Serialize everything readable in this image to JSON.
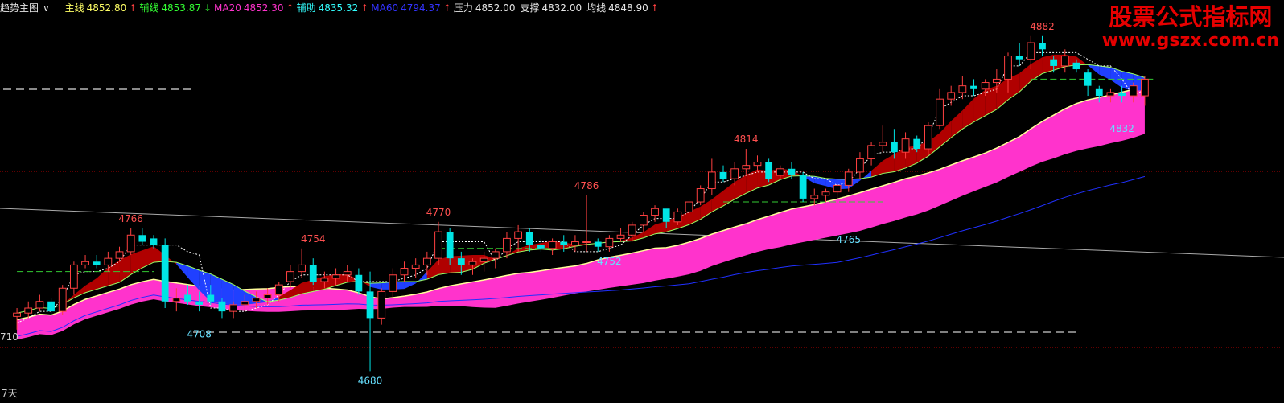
{
  "header": {
    "menu_label": "趋势主图",
    "menu_arrow": "∨",
    "items": [
      {
        "name": "主线",
        "value": "4852.80",
        "arrow": "↑",
        "color": "#ffff66"
      },
      {
        "name": "辅线",
        "value": "4853.87",
        "arrow": "↓",
        "color": "#33ff33"
      },
      {
        "name": "MA20",
        "value": "4852.30",
        "arrow": "↑",
        "color": "#ff33cc"
      },
      {
        "name": "辅助",
        "value": "4835.32",
        "arrow": "↑",
        "color": "#33ffff"
      },
      {
        "name": "MA60",
        "value": "4794.37",
        "arrow": "↑",
        "color": "#3333ff"
      },
      {
        "name": "压力",
        "value": "4852.00",
        "arrow": "",
        "color": "#e6e6e6"
      },
      {
        "name": "支撑",
        "value": "4832.00",
        "arrow": "",
        "color": "#e6e6e6"
      },
      {
        "name": "均线",
        "value": "4848.90",
        "arrow": "↑",
        "color": "#e6e6e6"
      }
    ]
  },
  "watermark": {
    "title": "股票公式指标网",
    "url": "www.gszx.com.cn",
    "title_color": "#e60000",
    "url_color": "#e60000"
  },
  "bottom_label": "7天",
  "left_label": "710",
  "colors": {
    "up": "#ff4040",
    "down": "#00e5e5",
    "ma60": "#2030ff",
    "band_pink": "#ff33cc",
    "band_red": "#b00000",
    "band_blue": "#2040ff",
    "grid": "#c00000"
  },
  "chart_data": {
    "type": "candlestick",
    "ylim": [
      4670,
      4895
    ],
    "candles": [
      [
        4713,
        4718,
        4705,
        4715
      ],
      [
        4715,
        4722,
        4712,
        4718
      ],
      [
        4718,
        4726,
        4716,
        4722
      ],
      [
        4722,
        4724,
        4714,
        4716
      ],
      [
        4716,
        4732,
        4714,
        4730
      ],
      [
        4730,
        4746,
        4726,
        4744
      ],
      [
        4744,
        4750,
        4742,
        4746
      ],
      [
        4746,
        4750,
        4742,
        4744
      ],
      [
        4744,
        4752,
        4740,
        4748
      ],
      [
        4748,
        4755,
        4746,
        4752
      ],
      [
        4752,
        4766,
        4750,
        4762
      ],
      [
        4762,
        4766,
        4756,
        4758
      ],
      [
        4760,
        4762,
        4754,
        4756
      ],
      [
        4756,
        4760,
        4718,
        4722
      ],
      [
        4722,
        4730,
        4716,
        4724
      ],
      [
        4726,
        4732,
        4720,
        4722
      ],
      [
        4722,
        4728,
        4716,
        4720
      ],
      [
        4726,
        4732,
        4720,
        4722
      ],
      [
        4722,
        4724,
        4712,
        4716
      ],
      [
        4716,
        4722,
        4712,
        4720
      ],
      [
        4720,
        4726,
        4716,
        4722
      ],
      [
        4722,
        4728,
        4718,
        4724
      ],
      [
        4724,
        4730,
        4720,
        4726
      ],
      [
        4726,
        4734,
        4722,
        4732
      ],
      [
        4734,
        4744,
        4730,
        4740
      ],
      [
        4740,
        4754,
        4736,
        4744
      ],
      [
        4744,
        4748,
        4732,
        4734
      ],
      [
        4734,
        4740,
        4730,
        4736
      ],
      [
        4736,
        4742,
        4732,
        4738
      ],
      [
        4738,
        4744,
        4734,
        4740
      ],
      [
        4738,
        4742,
        4726,
        4728
      ],
      [
        4728,
        4740,
        4680,
        4712
      ],
      [
        4712,
        4730,
        4708,
        4728
      ],
      [
        4728,
        4742,
        4724,
        4738
      ],
      [
        4738,
        4746,
        4734,
        4742
      ],
      [
        4742,
        4748,
        4736,
        4744
      ],
      [
        4744,
        4752,
        4738,
        4748
      ],
      [
        4748,
        4770,
        4744,
        4764
      ],
      [
        4764,
        4766,
        4744,
        4748
      ],
      [
        4748,
        4752,
        4738,
        4744
      ],
      [
        4744,
        4748,
        4738,
        4746
      ],
      [
        4746,
        4752,
        4740,
        4748
      ],
      [
        4748,
        4754,
        4742,
        4752
      ],
      [
        4752,
        4764,
        4748,
        4760
      ],
      [
        4760,
        4768,
        4752,
        4764
      ],
      [
        4764,
        4766,
        4752,
        4756
      ],
      [
        4756,
        4760,
        4752,
        4754
      ],
      [
        4754,
        4760,
        4750,
        4758
      ],
      [
        4758,
        4762,
        4752,
        4756
      ],
      [
        4756,
        4762,
        4752,
        4758
      ],
      [
        4758,
        4786,
        4752,
        4758
      ],
      [
        4758,
        4760,
        4752,
        4755
      ],
      [
        4755,
        4762,
        4752,
        4760
      ],
      [
        4760,
        4766,
        4758,
        4762
      ],
      [
        4762,
        4770,
        4758,
        4768
      ],
      [
        4768,
        4776,
        4764,
        4774
      ],
      [
        4774,
        4780,
        4770,
        4778
      ],
      [
        4778,
        4776,
        4766,
        4770
      ],
      [
        4770,
        4778,
        4768,
        4776
      ],
      [
        4776,
        4784,
        4772,
        4782
      ],
      [
        4782,
        4792,
        4780,
        4790
      ],
      [
        4790,
        4808,
        4786,
        4800
      ],
      [
        4800,
        4804,
        4794,
        4796
      ],
      [
        4796,
        4806,
        4792,
        4802
      ],
      [
        4802,
        4814,
        4798,
        4804
      ],
      [
        4804,
        4810,
        4800,
        4806
      ],
      [
        4806,
        4808,
        4794,
        4796
      ],
      [
        4798,
        4804,
        4796,
        4802
      ],
      [
        4802,
        4806,
        4796,
        4798
      ],
      [
        4798,
        4800,
        4782,
        4784
      ],
      [
        4784,
        4790,
        4780,
        4786
      ],
      [
        4786,
        4790,
        4782,
        4788
      ],
      [
        4788,
        4794,
        4784,
        4792
      ],
      [
        4792,
        4802,
        4788,
        4800
      ],
      [
        4800,
        4812,
        4796,
        4808
      ],
      [
        4808,
        4818,
        4804,
        4816
      ],
      [
        4816,
        4828,
        4812,
        4818
      ],
      [
        4818,
        4826,
        4808,
        4812
      ],
      [
        4812,
        4824,
        4808,
        4820
      ],
      [
        4820,
        4822,
        4812,
        4814
      ],
      [
        4814,
        4830,
        4810,
        4828
      ],
      [
        4828,
        4850,
        4826,
        4844
      ],
      [
        4844,
        4852,
        4840,
        4848
      ],
      [
        4848,
        4858,
        4844,
        4852
      ],
      [
        4852,
        4856,
        4846,
        4850
      ],
      [
        4850,
        4856,
        4846,
        4854
      ],
      [
        4854,
        4862,
        4848,
        4856
      ],
      [
        4856,
        4872,
        4848,
        4870
      ],
      [
        4870,
        4878,
        4864,
        4868
      ],
      [
        4868,
        4882,
        4862,
        4878
      ],
      [
        4878,
        4882,
        4870,
        4874
      ],
      [
        4868,
        4870,
        4860,
        4864
      ],
      [
        4864,
        4874,
        4860,
        4870
      ],
      [
        4866,
        4868,
        4860,
        4862
      ],
      [
        4860,
        4862,
        4846,
        4852
      ],
      [
        4850,
        4852,
        4842,
        4846
      ],
      [
        4846,
        4850,
        4842,
        4848
      ],
      [
        4848,
        4852,
        4842,
        4846
      ],
      [
        4846,
        4854,
        4842,
        4852
      ],
      [
        4846,
        4858,
        4840,
        4856
      ]
    ],
    "annotations": [
      {
        "index": 10,
        "value": 4766,
        "text": "4766",
        "pos": "above"
      },
      {
        "index": 26,
        "value": 4754,
        "text": "4754",
        "pos": "above"
      },
      {
        "index": 37,
        "value": 4770,
        "text": "4770",
        "pos": "above"
      },
      {
        "index": 50,
        "value": 4786,
        "text": "4786",
        "pos": "above"
      },
      {
        "index": 64,
        "value": 4814,
        "text": "4814",
        "pos": "above"
      },
      {
        "index": 90,
        "value": 4882,
        "text": "4882",
        "pos": "above"
      },
      {
        "index": 16,
        "value": 4708,
        "text": "4708",
        "pos": "below"
      },
      {
        "index": 31,
        "value": 4680,
        "text": "4680",
        "pos": "below"
      },
      {
        "index": 52,
        "value": 4752,
        "text": "4752",
        "pos": "below"
      },
      {
        "index": 73,
        "value": 4765,
        "text": "4765",
        "pos": "below"
      },
      {
        "index": 97,
        "value": 4832,
        "text": "4832",
        "pos": "below"
      }
    ]
  }
}
